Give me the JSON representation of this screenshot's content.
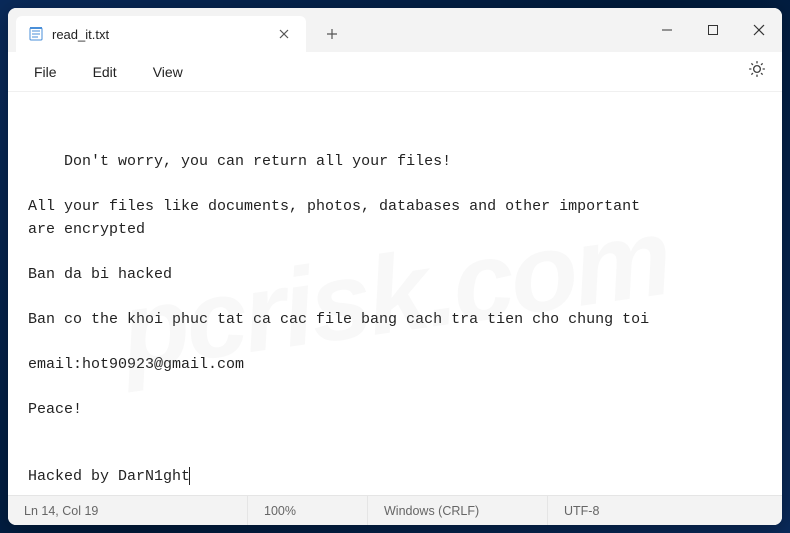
{
  "tab": {
    "title": "read_it.txt",
    "icon_name": "notepad-icon"
  },
  "menubar": {
    "file": "File",
    "edit": "Edit",
    "view": "View"
  },
  "content": {
    "text": "Don't worry, you can return all your files!\n\nAll your files like documents, photos, databases and other important\nare encrypted\n\nBan da bi hacked\n\nBan co the khoi phuc tat ca cac file bang cach tra tien cho chung toi\n\nemail:hot90923@gmail.com\n\nPeace!\n\n\nHacked by DarN1ght"
  },
  "statusbar": {
    "cursor_position": "Ln 14, Col 19",
    "zoom": "100%",
    "line_ending": "Windows (CRLF)",
    "encoding": "UTF-8"
  },
  "watermark": "pcrisk.com"
}
